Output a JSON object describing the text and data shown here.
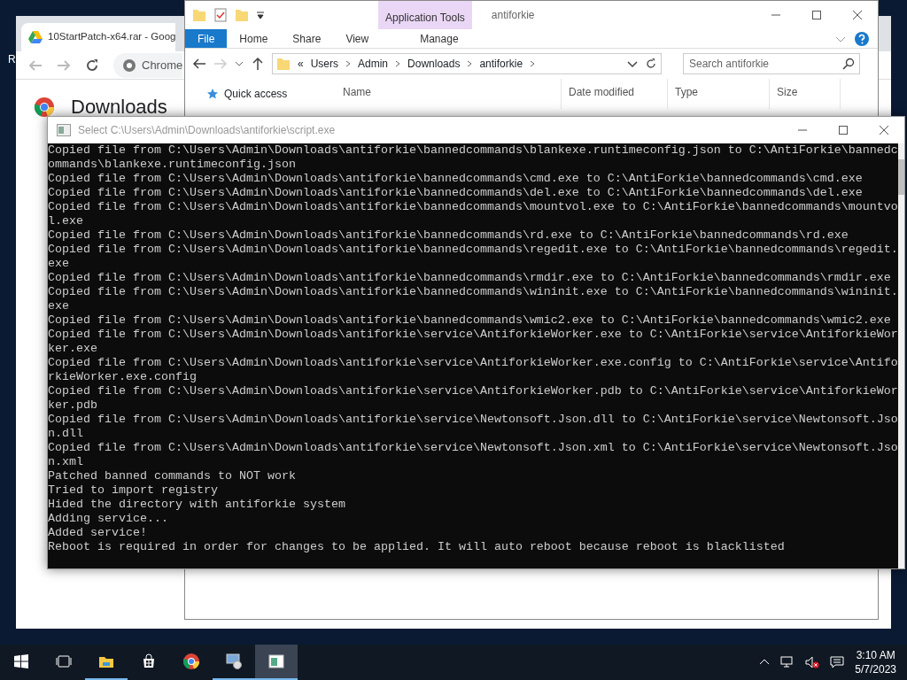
{
  "desktop": {
    "icon_label": "R"
  },
  "chrome": {
    "tab_title": "10StartPatch-x64.rar - Goog",
    "omnibox": "Chrome",
    "heading": "Downloads"
  },
  "explorer": {
    "ribbon_context": "Application Tools",
    "title": "antiforkie",
    "tabs": [
      {
        "label": "File",
        "selected": true
      },
      {
        "label": "Home",
        "selected": false
      },
      {
        "label": "Share",
        "selected": false
      },
      {
        "label": "View",
        "selected": false
      },
      {
        "label": "Manage",
        "selected": false
      }
    ],
    "breadcrumb_prefix": "«",
    "breadcrumb": [
      "Users",
      "Admin",
      "Downloads",
      "antiforkie"
    ],
    "search": {
      "placeholder": "Search antiforkie"
    },
    "nav_pane": [
      "Quick access"
    ],
    "columns": [
      "Name",
      "Date modified",
      "Type",
      "Size"
    ]
  },
  "console": {
    "title": "Select C:\\Users\\Admin\\Downloads\\antiforkie\\script.exe",
    "lines": [
      "Copied file from C:\\Users\\Admin\\Downloads\\antiforkie\\bannedcommands\\blankexe.runtimeconfig.json to C:\\AntiForkie\\bannedc",
      "ommands\\blankexe.runtimeconfig.json",
      "Copied file from C:\\Users\\Admin\\Downloads\\antiforkie\\bannedcommands\\cmd.exe to C:\\AntiForkie\\bannedcommands\\cmd.exe",
      "Copied file from C:\\Users\\Admin\\Downloads\\antiforkie\\bannedcommands\\del.exe to C:\\AntiForkie\\bannedcommands\\del.exe",
      "Copied file from C:\\Users\\Admin\\Downloads\\antiforkie\\bannedcommands\\mountvol.exe to C:\\AntiForkie\\bannedcommands\\mountvo",
      "l.exe",
      "Copied file from C:\\Users\\Admin\\Downloads\\antiforkie\\bannedcommands\\rd.exe to C:\\AntiForkie\\bannedcommands\\rd.exe",
      "Copied file from C:\\Users\\Admin\\Downloads\\antiforkie\\bannedcommands\\regedit.exe to C:\\AntiForkie\\bannedcommands\\regedit.",
      "exe",
      "Copied file from C:\\Users\\Admin\\Downloads\\antiforkie\\bannedcommands\\rmdir.exe to C:\\AntiForkie\\bannedcommands\\rmdir.exe",
      "Copied file from C:\\Users\\Admin\\Downloads\\antiforkie\\bannedcommands\\wininit.exe to C:\\AntiForkie\\bannedcommands\\wininit.",
      "exe",
      "Copied file from C:\\Users\\Admin\\Downloads\\antiforkie\\bannedcommands\\wmic2.exe to C:\\AntiForkie\\bannedcommands\\wmic2.exe",
      "Copied file from C:\\Users\\Admin\\Downloads\\antiforkie\\service\\AntiforkieWorker.exe to C:\\AntiForkie\\service\\AntiforkieWor",
      "ker.exe",
      "Copied file from C:\\Users\\Admin\\Downloads\\antiforkie\\service\\AntiforkieWorker.exe.config to C:\\AntiForkie\\service\\Antifo",
      "rkieWorker.exe.config",
      "Copied file from C:\\Users\\Admin\\Downloads\\antiforkie\\service\\AntiforkieWorker.pdb to C:\\AntiForkie\\service\\AntiforkieWor",
      "ker.pdb",
      "Copied file from C:\\Users\\Admin\\Downloads\\antiforkie\\service\\Newtonsoft.Json.dll to C:\\AntiForkie\\service\\Newtonsoft.Jso",
      "n.dll",
      "Copied file from C:\\Users\\Admin\\Downloads\\antiforkie\\service\\Newtonsoft.Json.xml to C:\\AntiForkie\\service\\Newtonsoft.Jso",
      "n.xml",
      "Patched banned commands to NOT work",
      "Tried to import registry",
      "Hided the directory with antiforkie system",
      "Adding service...",
      "Added service!",
      "Reboot is required in order for changes to be applied. It will auto reboot because reboot is blacklisted"
    ]
  },
  "taskbar": {
    "items": [
      {
        "kind": "taskview",
        "running": false,
        "selected": false
      },
      {
        "kind": "explorer",
        "running": true,
        "selected": false
      },
      {
        "kind": "store",
        "running": false,
        "selected": false
      },
      {
        "kind": "chrome",
        "running": false,
        "selected": false
      },
      {
        "kind": "monitor",
        "running": true,
        "selected": false
      },
      {
        "kind": "console",
        "running": true,
        "selected": true
      }
    ],
    "time": "3:10 AM",
    "date": "5/7/2023"
  }
}
